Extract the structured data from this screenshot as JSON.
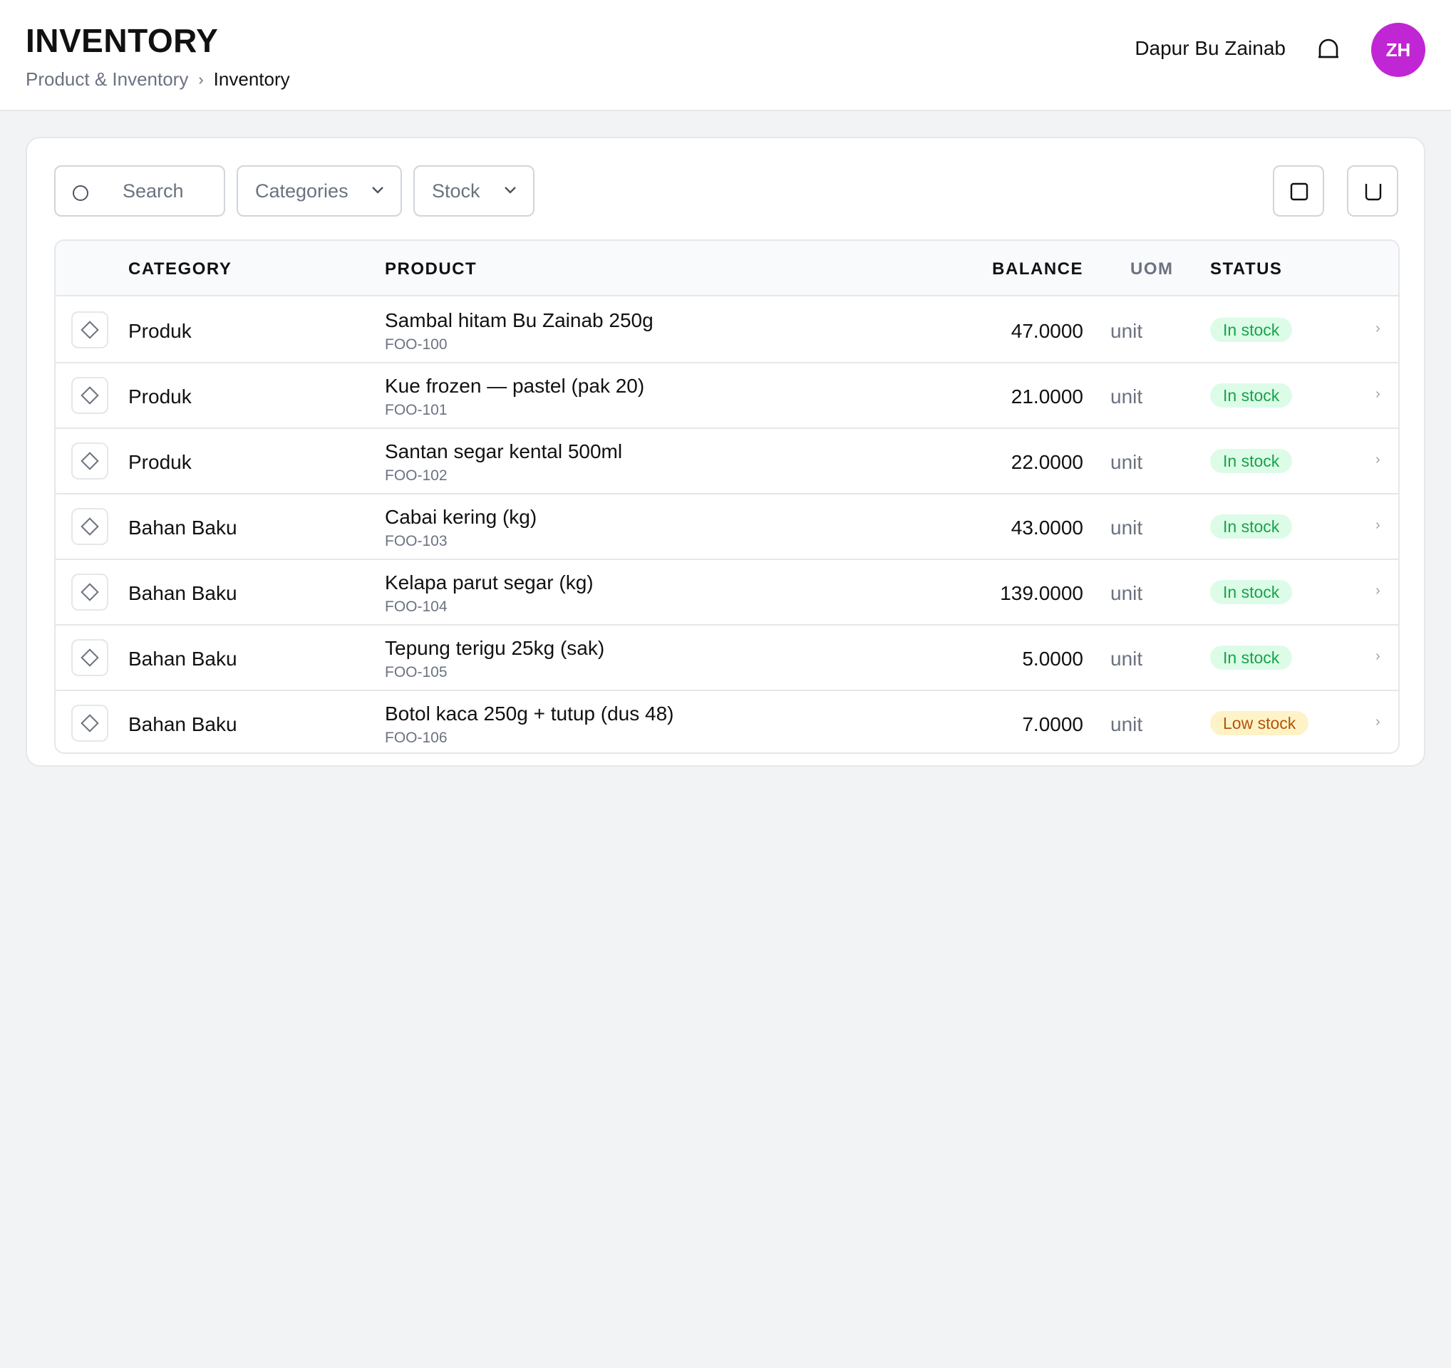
{
  "header": {
    "title": "INVENTORY",
    "breadcrumb": [
      "Product & Inventory",
      "Inventory"
    ],
    "breadcrumb_sep": "›",
    "store_name": "Dapur Bu Zainab",
    "avatar_initials": "ZH",
    "avatar_color": "#c026d3"
  },
  "toolbar": {
    "search_placeholder": "Search",
    "categories_label": "Categories",
    "stock_label": "Stock"
  },
  "table": {
    "columns": [
      "CATEGORY",
      "PRODUCT",
      "BALANCE",
      "UOM",
      "STATUS"
    ],
    "rows": [
      {
        "category": "Produk",
        "product": "Sambal hitam Bu Zainab 250g",
        "sku": "FOO-100",
        "balance": "47.0000",
        "uom": "unit",
        "status": "In stock",
        "status_type": "in"
      },
      {
        "category": "Produk",
        "product": "Kue frozen — pastel (pak 20)",
        "sku": "FOO-101",
        "balance": "21.0000",
        "uom": "unit",
        "status": "In stock",
        "status_type": "in"
      },
      {
        "category": "Produk",
        "product": "Santan segar kental 500ml",
        "sku": "FOO-102",
        "balance": "22.0000",
        "uom": "unit",
        "status": "In stock",
        "status_type": "in"
      },
      {
        "category": "Bahan Baku",
        "product": "Cabai kering (kg)",
        "sku": "FOO-103",
        "balance": "43.0000",
        "uom": "unit",
        "status": "In stock",
        "status_type": "in"
      },
      {
        "category": "Bahan Baku",
        "product": "Kelapa parut segar (kg)",
        "sku": "FOO-104",
        "balance": "139.0000",
        "uom": "unit",
        "status": "In stock",
        "status_type": "in"
      },
      {
        "category": "Bahan Baku",
        "product": "Tepung terigu 25kg (sak)",
        "sku": "FOO-105",
        "balance": "5.0000",
        "uom": "unit",
        "status": "In stock",
        "status_type": "in"
      },
      {
        "category": "Bahan Baku",
        "product": "Botol kaca 250g + tutup (dus 48)",
        "sku": "FOO-106",
        "balance": "7.0000",
        "uom": "unit",
        "status": "Low stock",
        "status_type": "low"
      }
    ],
    "row_arrow": "›"
  },
  "colors": {
    "in_stock_bg": "#dcfce7",
    "in_stock_text": "#16a34a",
    "low_stock_bg": "#fef3c7",
    "low_stock_text": "#b45309"
  }
}
